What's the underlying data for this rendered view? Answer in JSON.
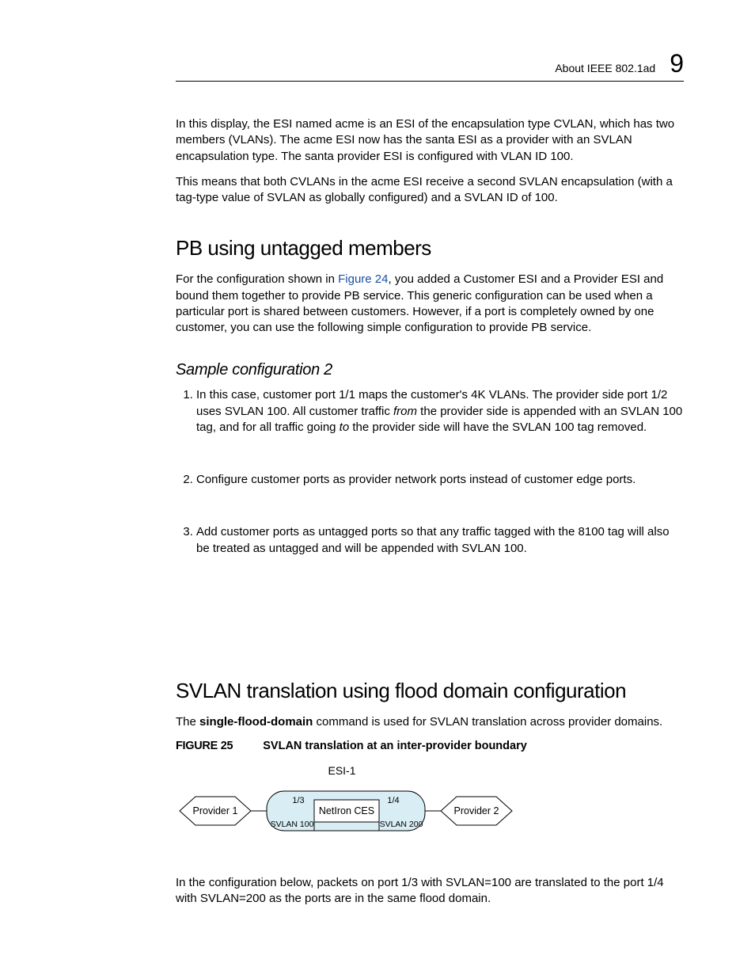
{
  "header": {
    "breadcrumb": "About IEEE 802.1ad",
    "chapter_number": "9"
  },
  "intro": {
    "p1": "In this display, the ESI named acme is an ESI of the encapsulation type CVLAN, which has two members (VLANs). The acme ESI now has the santa ESI as a provider with an SVLAN encapsulation type. The santa provider ESI is configured with VLAN ID 100.",
    "p2": "This means that both CVLANs in the acme ESI receive a second SVLAN encapsulation (with a tag-type value of SVLAN as globally configured) and a SVLAN ID of 100."
  },
  "section1": {
    "heading": "PB using untagged members",
    "para_prefix": "For the configuration shown in ",
    "link_text": "Figure 24",
    "para_suffix": ", you added a Customer ESI and a Provider ESI and bound them together to provide PB service. This generic configuration can be used when a particular port is shared between customers. However, if a port is completely owned by one customer, you can use the following simple configuration to provide PB service.",
    "subheading": "Sample configuration 2",
    "steps": {
      "s1_a": "In this case, customer port 1/1 maps the customer's 4K VLANs. The provider side port 1/2 uses SVLAN 100. All customer traffic ",
      "s1_from": "from",
      "s1_b": " the provider side is appended with an SVLAN 100 tag, and for all traffic going ",
      "s1_to": "to",
      "s1_c": " the provider side will have the SVLAN 100 tag removed.",
      "s2": "Configure customer ports as provider network ports instead of customer edge ports.",
      "s3": "Add customer ports as untagged ports so that any traffic tagged with the 8100 tag will also be treated as untagged and will be appended with SVLAN 100."
    }
  },
  "section2": {
    "heading": "SVLAN translation using flood domain configuration",
    "intro_a": "The ",
    "intro_bold": "single-flood-domain",
    "intro_b": " command is used for SVLAN translation across provider domains.",
    "figure": {
      "label": "FIGURE 25",
      "caption": "SVLAN translation at an inter-provider boundary",
      "diagram": {
        "top_label": "ESI-1",
        "left_hex": "Provider 1",
        "right_hex": "Provider 2",
        "center_box": "NetIron CES",
        "left_port": "1/3",
        "left_svlan": "SVLAN 100",
        "right_port": "1/4",
        "right_svlan": "SVLAN 200"
      }
    },
    "outro": "In the configuration below, packets on port 1/3 with SVLAN=100 are translated to the port 1/4 with SVLAN=200 as the ports are in the same flood domain."
  }
}
